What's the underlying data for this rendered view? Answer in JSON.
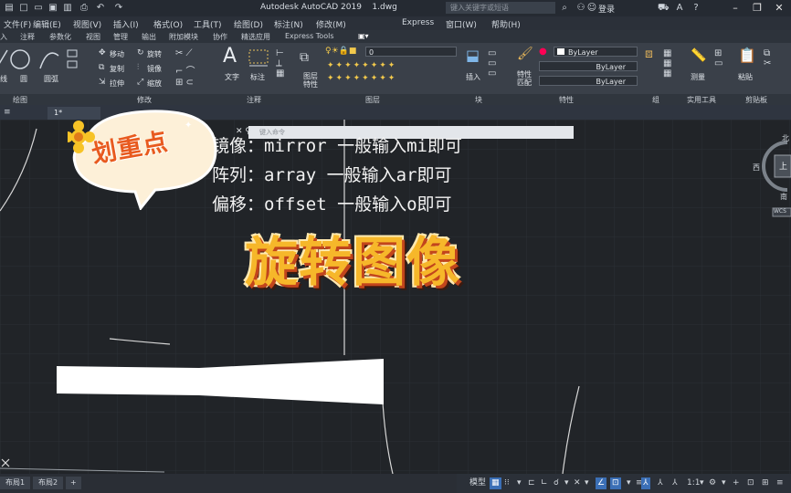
{
  "titlebar": {
    "app_title": "Autodesk AutoCAD 2019",
    "file_name": "1.dwg",
    "search_placeholder": "键入关键字或短语",
    "login_label": "登录"
  },
  "menu": [
    "文件(F)",
    "编辑(E)",
    "视图(V)",
    "插入(I)",
    "格式(O)",
    "工具(T)",
    "绘图(D)",
    "标注(N)",
    "修改(M)",
    "Express",
    "窗口(W)",
    "帮助(H)"
  ],
  "ribbon_tabs": [
    "入",
    "注释",
    "参数化",
    "视图",
    "管理",
    "输出",
    "附加模块",
    "协作",
    "精选应用",
    "Express Tools"
  ],
  "ribbon": {
    "draw": {
      "line": "线",
      "circle": "圆",
      "arc": "圆弧"
    },
    "modify": {
      "move": "移动",
      "rotate": "旋转",
      "copy": "复制",
      "mirror": "镜像",
      "stretch": "拉伸",
      "scale": "缩放"
    },
    "annotation": {
      "text": "文字",
      "dimension": "标注"
    },
    "layer": {
      "current": "0",
      "layer_props": "图层\n特性"
    },
    "block": {
      "insert": "插入"
    },
    "properties": {
      "match": "特性\n匹配",
      "color": "ByLayer",
      "linetype": "ByLayer",
      "lineweight": "ByLayer"
    },
    "group": "组",
    "utilities": {
      "measure": "测量"
    },
    "clipboard": {
      "paste": "粘贴"
    }
  },
  "panel_labels": [
    "绘图",
    "修改",
    "注释",
    "图层",
    "块",
    "特性",
    "组",
    "实用工具",
    "剪贴板"
  ],
  "doc_tab": "1*",
  "command_line": {
    "placeholder": "键入命令"
  },
  "subtitles": [
    "镜像：mirror  一般输入mi即可",
    "阵列：array 一般输入ar即可",
    "偏移：offset 一般输入o即可"
  ],
  "headline": "旋转图像",
  "sticker": "划重点",
  "navcube": {
    "north": "北",
    "west": "西",
    "south": "南",
    "top": "上",
    "wcs": "WCS"
  },
  "layout_tabs": [
    "布局1",
    "布局2"
  ],
  "status": {
    "model": "模型",
    "scale": "1:1"
  },
  "colors": {
    "headline_fill": "#f6b72a",
    "headline_shadow": "#c2451c",
    "sticker_text": "#e85a1f",
    "canvas": "#212428"
  }
}
